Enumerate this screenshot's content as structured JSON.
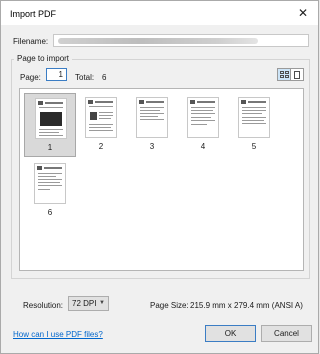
{
  "window": {
    "title": "Import PDF",
    "close_glyph": "✕"
  },
  "filename": {
    "label": "Filename:",
    "value": ""
  },
  "page_group": {
    "title": "Page to import",
    "page_label": "Page:",
    "page_value": "1",
    "total_label": "Total:",
    "total_value": "6"
  },
  "thumbnails": [
    {
      "label": "1",
      "selected": true
    },
    {
      "label": "2",
      "selected": false
    },
    {
      "label": "3",
      "selected": false
    },
    {
      "label": "4",
      "selected": false
    },
    {
      "label": "5",
      "selected": false
    },
    {
      "label": "6",
      "selected": false
    }
  ],
  "resolution": {
    "label": "Resolution:",
    "value": "72 DPI"
  },
  "page_size": {
    "label": "Page Size:",
    "value": "215.9 mm x 279.4 mm (ANSI A)"
  },
  "help_link": "How can I use PDF files?",
  "buttons": {
    "ok": "OK",
    "cancel": "Cancel"
  },
  "colors": {
    "selection": "#d9d9d9",
    "link": "#0066cc",
    "focus": "#3b7dc4"
  }
}
